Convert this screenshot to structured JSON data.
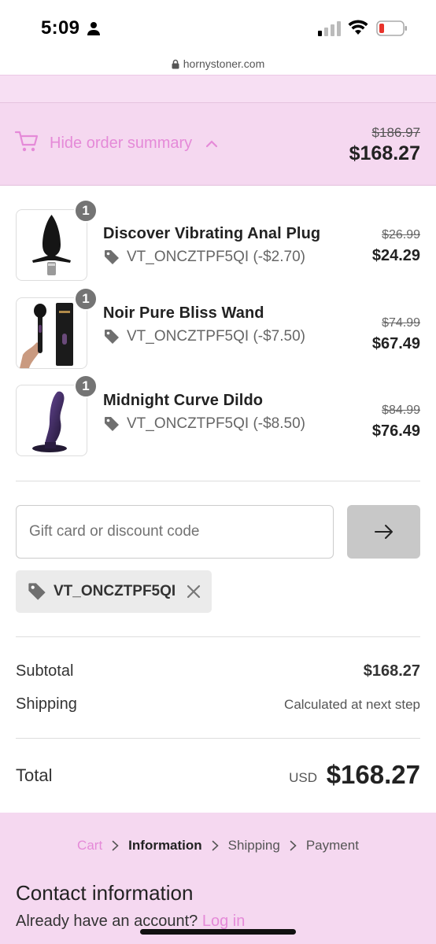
{
  "status_bar": {
    "time": "5:09"
  },
  "browser": {
    "url": "hornystoner.com"
  },
  "summary": {
    "toggle_label": "Hide order summary",
    "original_total": "$186.97",
    "total": "$168.27"
  },
  "products": [
    {
      "qty": "1",
      "name": "Discover Vibrating Anal Plug",
      "discount": "VT_ONCZTPF5QI (-$2.70)",
      "original_price": "$26.99",
      "price": "$24.29"
    },
    {
      "qty": "1",
      "name": "Noir Pure Bliss Wand",
      "discount": "VT_ONCZTPF5QI (-$7.50)",
      "original_price": "$74.99",
      "price": "$67.49"
    },
    {
      "qty": "1",
      "name": "Midnight Curve Dildo",
      "discount": "VT_ONCZTPF5QI (-$8.50)",
      "original_price": "$84.99",
      "price": "$76.49"
    }
  ],
  "discount": {
    "placeholder": "Gift card or discount code",
    "applied_code": "VT_ONCZTPF5QI"
  },
  "totals": {
    "subtotal_label": "Subtotal",
    "subtotal": "$168.27",
    "shipping_label": "Shipping",
    "shipping": "Calculated at next step",
    "total_label": "Total",
    "currency": "USD",
    "total": "$168.27"
  },
  "breadcrumb": [
    "Cart",
    "Information",
    "Shipping",
    "Payment"
  ],
  "contact": {
    "title": "Contact information",
    "account_prompt": "Already have an account?",
    "login_label": "Log in"
  },
  "colors": {
    "accent": "#e58ad8",
    "pink_bg": "#f5d8f0"
  }
}
